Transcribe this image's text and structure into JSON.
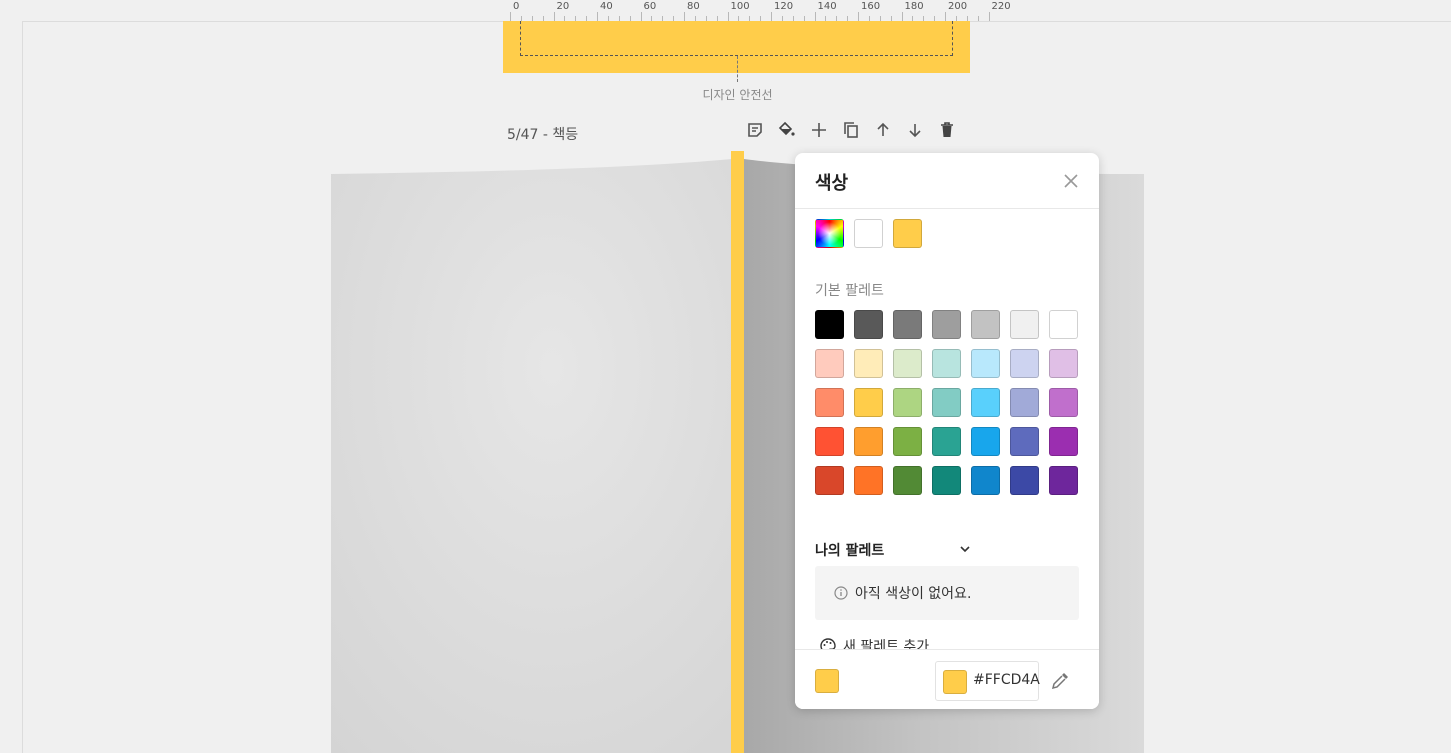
{
  "ruler": {
    "labels": [
      "0",
      "20",
      "40",
      "60",
      "80",
      "100",
      "120",
      "140",
      "160",
      "180",
      "200",
      "220"
    ]
  },
  "spine": {
    "color": "#ffcd4a",
    "safe_line_label": "디자인 안전선"
  },
  "page": {
    "label": "5/47 - 책등"
  },
  "toolbar": {
    "icons": [
      "note-icon",
      "paint-bucket-icon",
      "plus-icon",
      "copy-icon",
      "arrow-up-icon",
      "arrow-down-icon",
      "trash-icon"
    ]
  },
  "color_panel": {
    "title": "색상",
    "recent_colors": [
      "#ffffff",
      "#ffcd4a"
    ],
    "basic_palette_label": "기본 팔레트",
    "basic_palette": [
      "#000000",
      "#595959",
      "#7a7a7a",
      "#9e9e9e",
      "#c2c2c2",
      "#f0f0f0",
      "#ffffff",
      "#ffcbbd",
      "#ffecb8",
      "#dcebcb",
      "#b8e4df",
      "#b8e8fc",
      "#cdd3f0",
      "#e0bfe6",
      "#ff8c69",
      "#ffcd4a",
      "#add582",
      "#82ccc4",
      "#59d0fc",
      "#a1aad8",
      "#c06fcc",
      "#ff5233",
      "#ff9e2e",
      "#7cb044",
      "#2aa393",
      "#18a6ec",
      "#5e6bbd",
      "#9b2eb0",
      "#d9472a",
      "#ff7326",
      "#528a35",
      "#12887a",
      "#1086cc",
      "#3c49a6",
      "#6e269c"
    ],
    "my_palette_label": "나의 팔레트",
    "empty_message": "아직 색상이 없어요.",
    "add_palette_label": "새 팔레트 추가",
    "current_color": "#ffcd4a",
    "hex_value": "#FFCD4A"
  }
}
